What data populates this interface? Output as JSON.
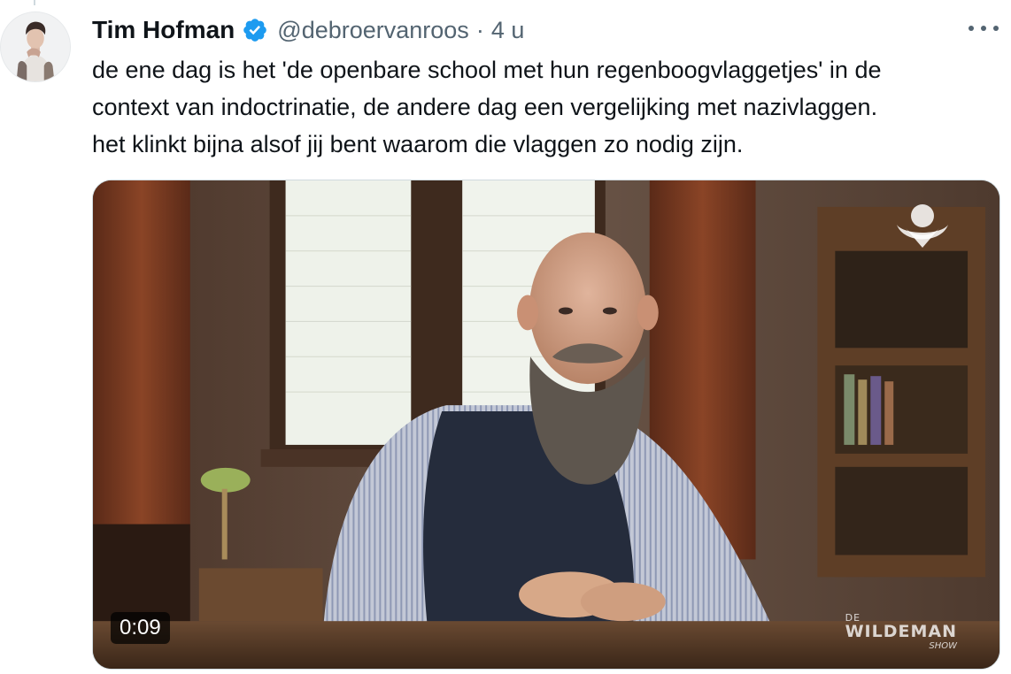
{
  "tweet": {
    "author_name": "Tim Hofman",
    "handle": "@debroervanroos",
    "separator": "·",
    "time": "4 u",
    "verified": true,
    "text_lines": [
      "de ene dag is het 'de openbare school met hun regenboogvlaggetjes' in de",
      "context van indoctrinatie, de andere dag een vergelijking met nazivlaggen.",
      "het klinkt bijna alsof jij bent waarom die vlaggen zo nodig zijn."
    ]
  },
  "media": {
    "type": "video",
    "duration": "0:09",
    "show_logo": {
      "prefix": "DE",
      "name": "WILDEMAN",
      "suffix": "SHOW"
    }
  },
  "colors": {
    "text_primary": "#0f1419",
    "text_secondary": "#536471",
    "verified_blue": "#1d9bf0",
    "border": "#cfd9de"
  },
  "icons": {
    "verified": "verified-badge-icon",
    "more": "more-options-icon",
    "channel": "channel-logo-icon"
  }
}
